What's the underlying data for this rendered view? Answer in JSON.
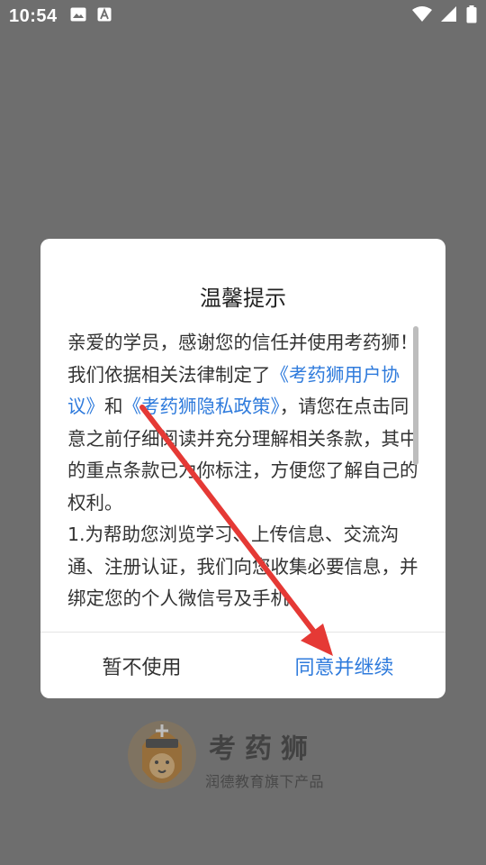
{
  "status_bar": {
    "time": "10:54",
    "left_icons": [
      "image-icon",
      "a-icon"
    ],
    "right_icons": [
      "wifi-icon",
      "signal-icon",
      "battery-icon"
    ]
  },
  "splash": {
    "app_name": "考药狮",
    "subtitle": "润德教育旗下产品"
  },
  "dialog": {
    "title": "温馨提示",
    "body": {
      "intro_1": "亲爱的学员，感谢您的信任并使用考药狮！我们依据相关法律制定了",
      "link_user_agreement": "《考药狮用户协议》",
      "and": "和",
      "link_privacy_policy": "《考药狮隐私政策》",
      "intro_2": "，请您在点击同意之前仔细阅读并充分理解相关条款，其中的重点条款已为你标注，方便您了解自己的权利。",
      "item_1": "1.为帮助您浏览学习、上传信息、交流沟通、注册认证，我们向您收集必要信息，并绑定您的个人微信号及手机"
    },
    "buttons": {
      "decline": "暂不使用",
      "agree": "同意并继续"
    }
  },
  "colors": {
    "link": "#2f7bdc",
    "overlay": "#6e6e6e",
    "annotation_arrow": "#e53935"
  }
}
